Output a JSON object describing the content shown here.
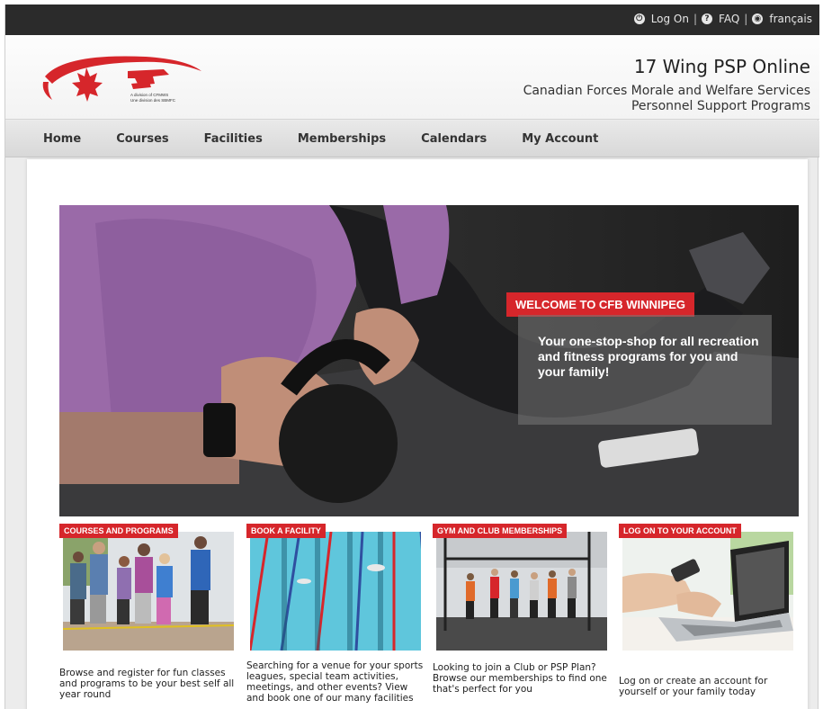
{
  "topbar": {
    "login_label": "Log On",
    "faq_label": "FAQ",
    "lang_label": "français",
    "separator": "|"
  },
  "header": {
    "logo_caption_en": "A division of CFMWS",
    "logo_caption_fr": "Une division des SBMFC",
    "title": "17 Wing PSP Online",
    "subtitle_line1": "Canadian Forces Morale and Welfare Services",
    "subtitle_line2": "Personnel Support Programs"
  },
  "nav": {
    "items": [
      {
        "label": "Home"
      },
      {
        "label": "Courses"
      },
      {
        "label": "Facilities"
      },
      {
        "label": "Memberships"
      },
      {
        "label": "Calendars"
      },
      {
        "label": "My Account"
      }
    ]
  },
  "hero": {
    "tag": "WELCOME TO CFB WINNIPEG",
    "text": "Your one-stop-shop for all recreation and fitness programs for you and your family!"
  },
  "cards": [
    {
      "tag": "COURSES AND PROGRAMS",
      "desc": "Browse and register for fun classes and programs to be your best self all year round"
    },
    {
      "tag": "BOOK A FACILITY",
      "desc": "Searching for a venue for your sports leagues, special team activities, meetings, and other events? View and book one of our many facilities"
    },
    {
      "tag": "GYM AND CLUB MEMBERSHIPS",
      "desc": "Looking to join a Club or PSP Plan? Browse our memberships to find one that's perfect for you"
    },
    {
      "tag": "LOG ON TO YOUR ACCOUNT",
      "desc": "Log on or create an account for yourself or your family today"
    }
  ],
  "colors": {
    "brand_red": "#d6262b",
    "topbar": "#2b2b2b"
  },
  "icons": [
    "power-icon",
    "question-icon",
    "globe-icon"
  ]
}
